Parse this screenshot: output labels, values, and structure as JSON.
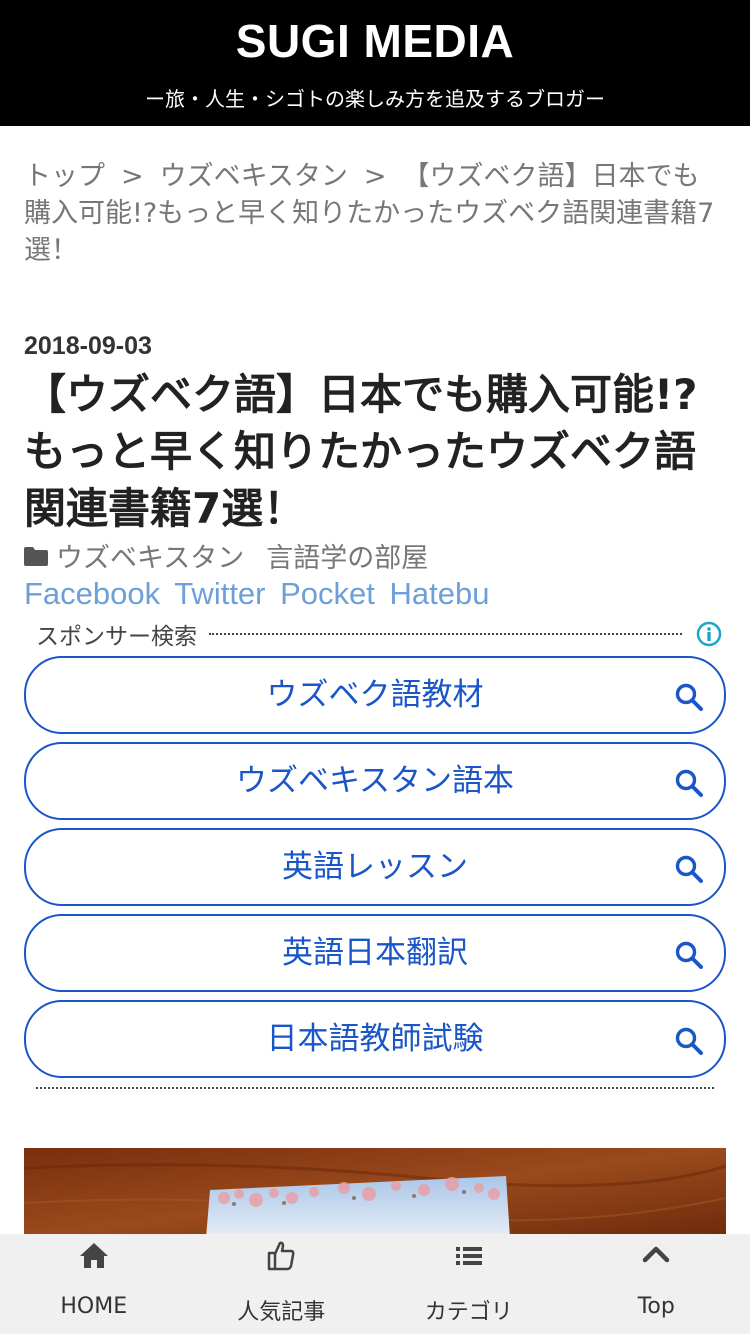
{
  "header": {
    "site_title": "SUGI MEDIA",
    "tagline": "ー旅・人生・シゴトの楽しみ方を追及するブロガー"
  },
  "breadcrumb": {
    "items": [
      "トップ",
      "ウズベキスタン",
      "【ウズベク語】日本でも購入可能!?もっと早く知りたかったウズベク語関連書籍7選！"
    ],
    "separator": ">"
  },
  "post": {
    "date": "2018-09-03",
    "title": "【ウズベク語】日本でも購入可能!?もっと早く知りたかったウズベク語関連書籍7選！",
    "categories": [
      "ウズベキスタン",
      "言語学の部屋"
    ],
    "share": [
      "Facebook",
      "Twitter",
      "Pocket",
      "Hatebu"
    ]
  },
  "sponsor": {
    "label": "スポンサー検索",
    "searches": [
      "ウズベク語教材",
      "ウズベキスタン語本",
      "英語レッスン",
      "英語日本翻訳",
      "日本語教師試験"
    ]
  },
  "tabbar": {
    "items": [
      {
        "label": "HOME",
        "icon": "home-icon"
      },
      {
        "label": "人気記事",
        "icon": "thumbs-up-icon"
      },
      {
        "label": "カテゴリ",
        "icon": "list-icon"
      },
      {
        "label": "Top",
        "icon": "chevron-up-icon"
      }
    ]
  },
  "colors": {
    "header_bg": "#000000",
    "share_link": "#6d9fd8",
    "search_accent": "#1a56c7",
    "info_icon": "#1aa7c7",
    "tabbar_bg": "#f0f0f0"
  }
}
